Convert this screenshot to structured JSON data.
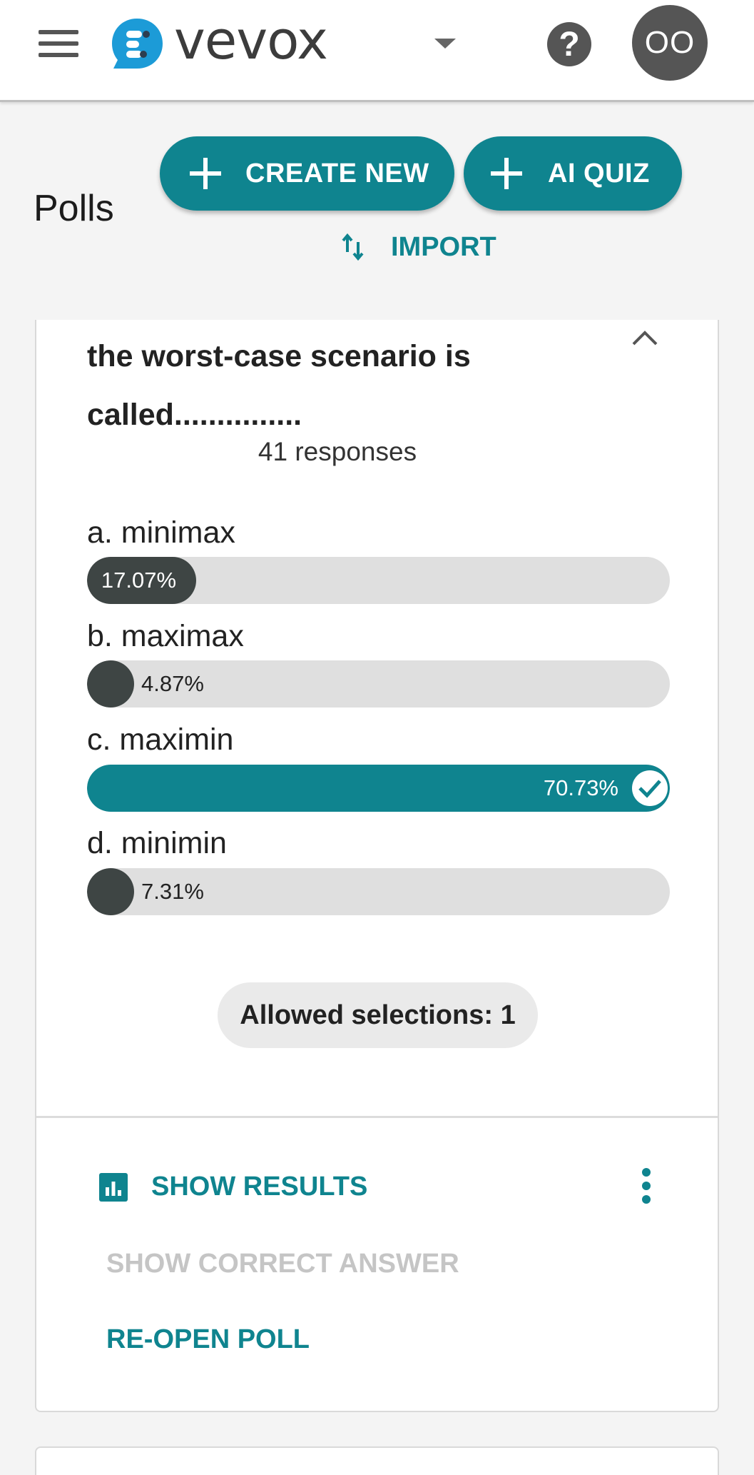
{
  "header": {
    "brand": "vevox",
    "help_glyph": "?",
    "avatar_initials": "OO",
    "icons": {
      "menu": "hamburger-menu-icon",
      "logo": "vevox-logo-icon",
      "dropdown": "caret-down-icon",
      "help": "help-icon"
    }
  },
  "page": {
    "title": "Polls",
    "create_new_label": "CREATE NEW",
    "ai_quiz_label": "AI QUIZ",
    "import_label": "IMPORT"
  },
  "poll": {
    "question_line1": "the worst-case scenario is",
    "question_line2": "called...............",
    "responses_label": "41 responses",
    "options": [
      {
        "label": "a. minimax",
        "percent_text": "17.07%",
        "fraction": 0.1707,
        "correct": false
      },
      {
        "label": "b. maximax",
        "percent_text": "4.87%",
        "fraction": 0.0487,
        "correct": false
      },
      {
        "label": "c. maximin",
        "percent_text": "70.73%",
        "fraction": 0.7073,
        "correct": true
      },
      {
        "label": "d. minimin",
        "percent_text": "7.31%",
        "fraction": 0.0731,
        "correct": false
      }
    ],
    "allowed_selections": "Allowed selections: 1",
    "actions": {
      "show_results": "SHOW RESULTS",
      "show_correct_answer": "SHOW CORRECT ANSWER",
      "reopen_poll": "RE-OPEN POLL"
    }
  },
  "colors": {
    "accent": "#0f848f",
    "bar_dark": "#3e4544",
    "bar_track": "#dfdfdf",
    "disabled_text": "#c5c5c5"
  }
}
